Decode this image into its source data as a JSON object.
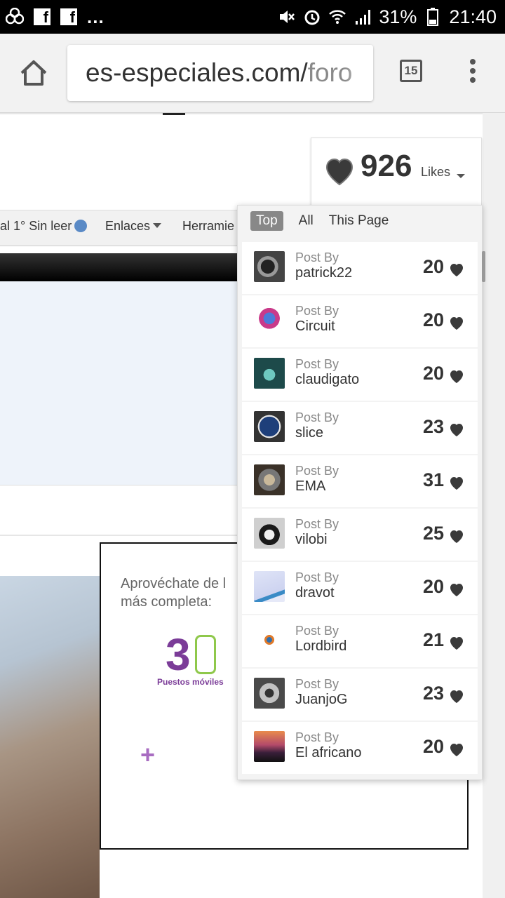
{
  "status_bar": {
    "battery": "31%",
    "time": "21:40",
    "notif_dots": "...",
    "fb_label": "f"
  },
  "browser": {
    "url_main": "es-especiales.com/",
    "url_rest": "foro",
    "tab_count": "15"
  },
  "page": {
    "nav": {
      "item1": "al 1° Sin leer",
      "item2": "Enlaces",
      "item3": "Herramie"
    },
    "ad": {
      "line1": "Aprovéchate de l",
      "line2": "más completa:",
      "number": "3",
      "sub": "Puestos móviles",
      "plus": "+"
    }
  },
  "likes": {
    "total": "926",
    "label": "Likes",
    "tabs": [
      "Top",
      "All",
      "This Page"
    ],
    "entries": [
      {
        "prefix": "Post By",
        "user": "patrick22",
        "count": "20"
      },
      {
        "prefix": "Post By",
        "user": "Circuit",
        "count": "20"
      },
      {
        "prefix": "Post By",
        "user": "claudigato",
        "count": "20"
      },
      {
        "prefix": "Post By",
        "user": "slice",
        "count": "23"
      },
      {
        "prefix": "Post By",
        "user": "EMA",
        "count": "31"
      },
      {
        "prefix": "Post By",
        "user": "vilobi",
        "count": "25"
      },
      {
        "prefix": "Post By",
        "user": "dravot",
        "count": "20"
      },
      {
        "prefix": "Post By",
        "user": "Lordbird",
        "count": "21"
      },
      {
        "prefix": "Post By",
        "user": "JuanjoG",
        "count": "23"
      },
      {
        "prefix": "Post By",
        "user": "El africano",
        "count": "20"
      }
    ]
  },
  "colors": {
    "heart": "#3a3a3a",
    "active_tab": "#888888",
    "ad_purple": "#7b3c98",
    "ad_green": "#8fc84b"
  }
}
